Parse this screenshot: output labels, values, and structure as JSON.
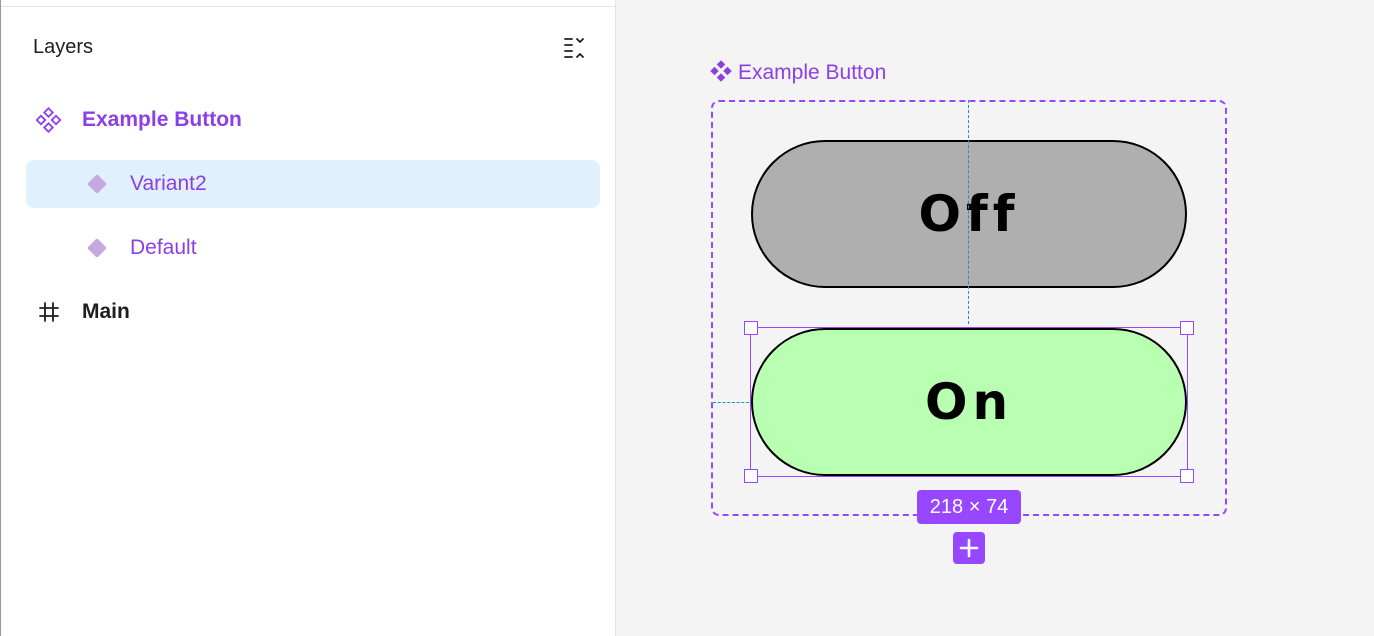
{
  "layers_panel": {
    "title": "Layers",
    "options_icon": "list-sort-icon",
    "items": [
      {
        "label": "Example Button",
        "icon": "component-set-icon",
        "color": "#8b3fe5",
        "bold": true,
        "selected": false
      },
      {
        "label": "Variant2",
        "icon": "variant-diamond-icon",
        "color": "#8b3fe5",
        "bold": false,
        "selected": true
      },
      {
        "label": "Default",
        "icon": "variant-diamond-icon",
        "color": "#8b3fe5",
        "bold": false,
        "selected": false
      },
      {
        "label": "Main",
        "icon": "frame-hash-icon",
        "color": "#1e1e1e",
        "bold": true,
        "selected": false
      }
    ]
  },
  "canvas": {
    "component_label": "Example Button",
    "variants": [
      {
        "label": "Off",
        "fill": "#afafaf"
      },
      {
        "label": "On",
        "fill": "#b9ffb1"
      }
    ],
    "size_badge": "218 × 74",
    "add_icon": "plus-icon"
  },
  "colors": {
    "accent": "#9747ff",
    "component_text": "#8b3fe5",
    "selection_row": "#e0f0fc",
    "guide": "#1b8ed6"
  }
}
